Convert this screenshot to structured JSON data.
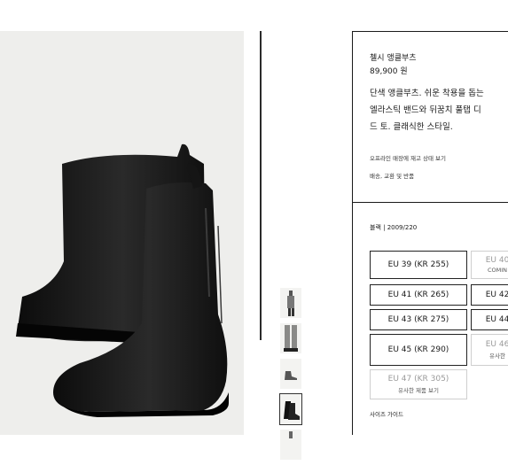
{
  "product": {
    "name": "첼시 앵클부츠",
    "price": "89,900 원",
    "description": "단색 앵클부츠. 쉬운 착용을 돕는\n엘라스틱 밴드와 뒤꿈치 풀탭 디\n드 토. 클래식한 스타일.",
    "stock_link": "오프라인 매장에 재고 상태 보기",
    "shipping_link": "배송, 교환 및 반품",
    "color_label": "블랙 | 2009/220",
    "size_guide": "사이즈 가이드"
  },
  "sizes": [
    {
      "label": "EU 39 (KR 255)",
      "sub": ""
    },
    {
      "label": "EU 40",
      "sub": "COMIN"
    },
    {
      "label": "EU 41 (KR 265)",
      "sub": ""
    },
    {
      "label": "EU 42",
      "sub": ""
    },
    {
      "label": "EU 43 (KR 275)",
      "sub": ""
    },
    {
      "label": "EU 44",
      "sub": ""
    },
    {
      "label": "EU 45 (KR 290)",
      "sub": ""
    },
    {
      "label": "EU 46",
      "sub": "유사한"
    },
    {
      "label": "EU 47 (KR 305)",
      "sub": "유사한 제품 보기"
    }
  ],
  "thumbnails": [
    "full-look-photo",
    "trousers-boot-photo",
    "boot-side-photo",
    "boot-pair-photo",
    "boot-detail-photo"
  ]
}
